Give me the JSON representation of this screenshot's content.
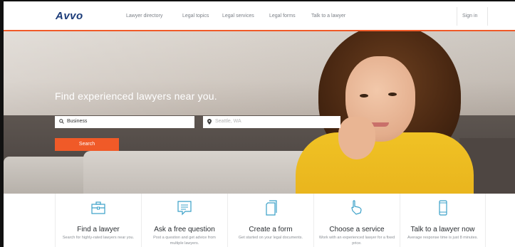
{
  "header": {
    "logo": "Avvo",
    "nav": [
      {
        "label": "Lawyer directory"
      },
      {
        "label": "Legal topics"
      },
      {
        "label": "Legal services"
      },
      {
        "label": "Legal forms"
      },
      {
        "label": "Talk to a lawyer"
      }
    ],
    "sign_in": "Sign in"
  },
  "hero": {
    "title": "Find experienced lawyers near you.",
    "search": {
      "value": "Business",
      "icon": "search-icon"
    },
    "location": {
      "placeholder": "Seattle, WA",
      "icon": "location-pin-icon"
    },
    "search_button": "Search"
  },
  "services": [
    {
      "icon": "briefcase-icon",
      "title": "Find a lawyer",
      "desc": "Search for highly-rated lawyers near you."
    },
    {
      "icon": "chat-bubble-icon",
      "title": "Ask a free question",
      "desc": "Post a question and get advice from multiple lawyers."
    },
    {
      "icon": "document-icon",
      "title": "Create a form",
      "desc": "Get started on your legal documents."
    },
    {
      "icon": "hand-pointer-icon",
      "title": "Choose a service",
      "desc": "Work with an experienced lawyer for a fixed price."
    },
    {
      "icon": "phone-icon",
      "title": "Talk to a lawyer now",
      "desc": "Average response time is just 8 minutes."
    }
  ],
  "colors": {
    "accent": "#f05a28",
    "logo": "#1a3a78",
    "icon": "#3aa0c8"
  }
}
